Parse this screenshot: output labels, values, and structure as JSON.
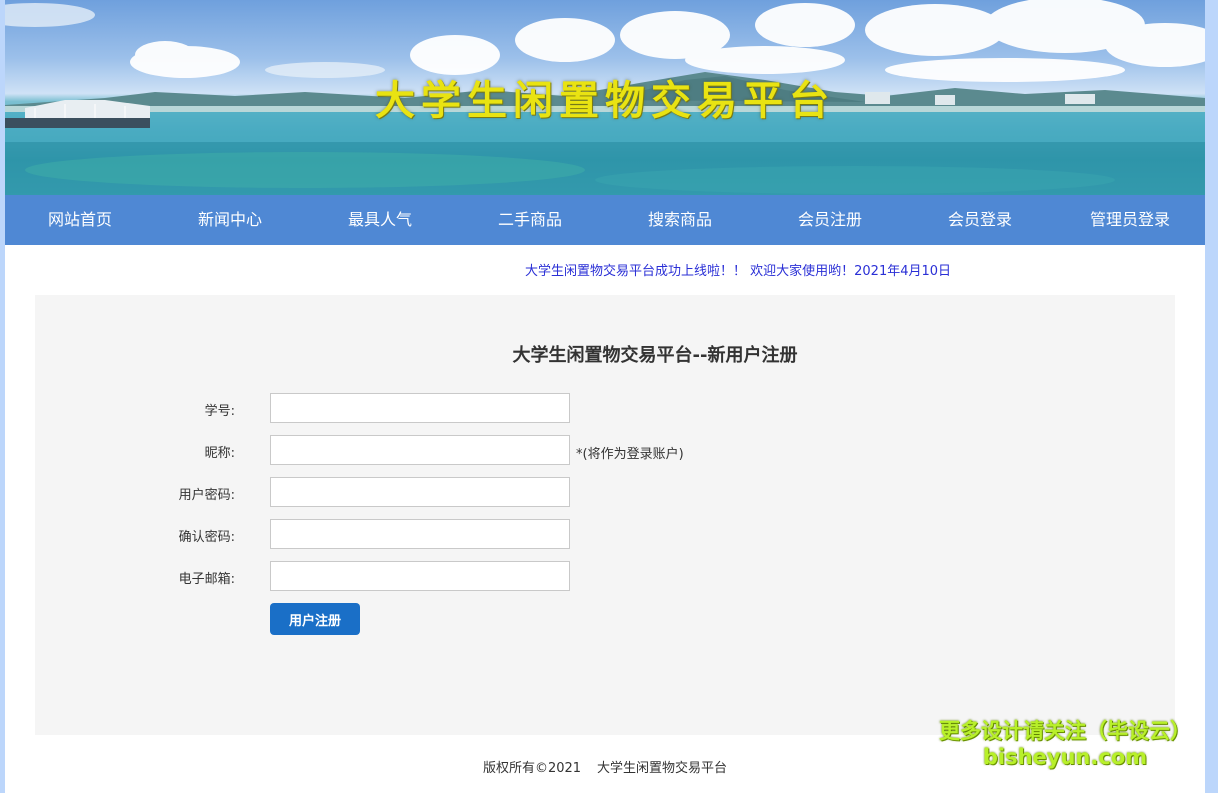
{
  "banner": {
    "title": "大学生闲置物交易平台"
  },
  "nav": {
    "items": [
      {
        "label": "网站首页"
      },
      {
        "label": "新闻中心"
      },
      {
        "label": "最具人气"
      },
      {
        "label": "二手商品"
      },
      {
        "label": "搜索商品"
      },
      {
        "label": "会员注册"
      },
      {
        "label": "会员登录"
      },
      {
        "label": "管理员登录"
      }
    ]
  },
  "notice": "大学生闲置物交易平台成功上线啦！！ 欢迎大家使用哟！2021年4月10日",
  "form": {
    "title": "大学生闲置物交易平台--新用户注册",
    "fields": [
      {
        "label": "学号:",
        "value": ""
      },
      {
        "label": "昵称:",
        "value": "",
        "hint": "*(将作为登录账户)"
      },
      {
        "label": "用户密码:",
        "value": ""
      },
      {
        "label": "确认密码:",
        "value": ""
      },
      {
        "label": "电子邮箱:",
        "value": ""
      }
    ],
    "submit_label": "用户注册"
  },
  "footer": {
    "copyright": "版权所有©2021",
    "site": "大学生闲置物交易平台"
  },
  "watermark": {
    "line1": "更多设计请关注（毕设云）",
    "line2": "bisheyun.com"
  },
  "colors": {
    "nav": "#4f88d4",
    "button": "#1a6fc7",
    "notice": "#2a2fd6",
    "title": "#e9e312"
  }
}
